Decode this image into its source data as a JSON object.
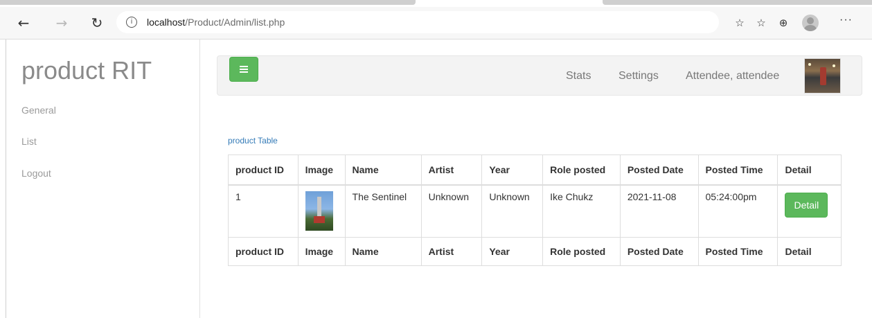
{
  "browser": {
    "url_host": "localhost",
    "url_path": "/Product/Admin/list.php",
    "icons": [
      "back-icon",
      "forward-icon",
      "refresh-icon",
      "info-icon",
      "favorite-add-icon",
      "favorites-icon",
      "collections-icon",
      "profile-icon",
      "more-icon"
    ]
  },
  "sidebar": {
    "brand": "product RIT",
    "items": [
      {
        "label": "General"
      },
      {
        "label": "List"
      },
      {
        "label": "Logout"
      }
    ]
  },
  "topbar": {
    "links": [
      {
        "label": "Stats"
      },
      {
        "label": "Settings"
      },
      {
        "label": "Attendee, attendee"
      }
    ]
  },
  "table": {
    "caption": "product Table",
    "headers": [
      "product ID",
      "Image",
      "Name",
      "Artist",
      "Year",
      "Role posted",
      "Posted Date",
      "Posted Time",
      "Detail"
    ],
    "rows": [
      {
        "id": "1",
        "name": "The Sentinel",
        "artist": "Unknown",
        "year": "Unknown",
        "role": "Ike Chukz",
        "date": "2021-11-08",
        "time": "05:24:00pm",
        "detail_label": "Detail"
      }
    ]
  },
  "colors": {
    "accent_green": "#5cb85c",
    "link_blue": "#337ab7"
  }
}
